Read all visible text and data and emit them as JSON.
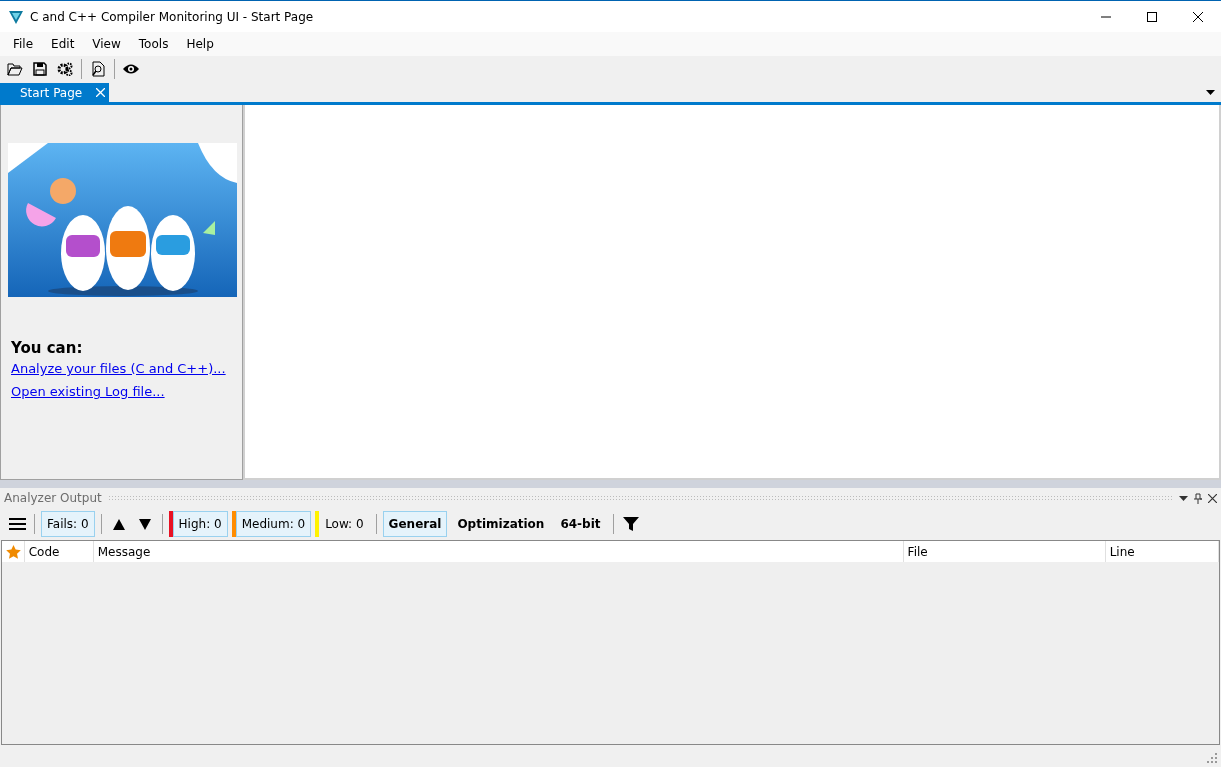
{
  "window": {
    "title": "C and C++ Compiler Monitoring UI - Start Page"
  },
  "menu": [
    "File",
    "Edit",
    "View",
    "Tools",
    "Help"
  ],
  "tabs": [
    {
      "label": "Start Page",
      "selected": true
    }
  ],
  "start_page": {
    "heading": "You can:",
    "links": [
      "Analyze your files (C and C++)...",
      "Open existing Log file..."
    ]
  },
  "output_panel": {
    "title": "Analyzer Output",
    "filters": [
      {
        "kind": "toggle",
        "label": "Fails: 0",
        "selected": true
      },
      {
        "kind": "level",
        "label": "High: 0",
        "selected": true,
        "color": "#e81123"
      },
      {
        "kind": "level",
        "label": "Medium: 0",
        "selected": true,
        "color": "#ff8c00"
      },
      {
        "kind": "level",
        "label": "Low: 0",
        "selected": false,
        "color": "#fff200"
      },
      {
        "kind": "group",
        "label": "General",
        "selected": true
      },
      {
        "kind": "group",
        "label": "Optimization",
        "selected": false
      },
      {
        "kind": "group",
        "label": "64-bit",
        "selected": false
      }
    ],
    "columns": [
      "Code",
      "Message",
      "File",
      "Line"
    ]
  }
}
